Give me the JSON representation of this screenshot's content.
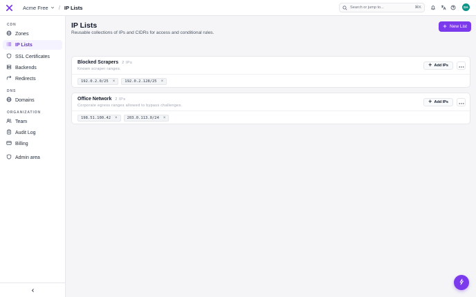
{
  "colors": {
    "accent": "#7c3aed",
    "avatar_bg": "#0d9488"
  },
  "header": {
    "org": "Acme Free",
    "separator": "/",
    "page": "IP Lists",
    "search": {
      "placeholder": "Search or jump to...",
      "shortcut": "⌘K"
    },
    "avatar_initials": "DA",
    "icons": [
      "logo-icon",
      "bell-icon",
      "translate-icon",
      "help-icon"
    ]
  },
  "sidebar": {
    "sections": [
      {
        "label": "CDN",
        "items": [
          {
            "label": "Zones",
            "icon": "globe-icon"
          },
          {
            "label": "IP Lists",
            "icon": "list-icon",
            "active": true
          },
          {
            "label": "SSL Certificates",
            "icon": "shield-icon"
          },
          {
            "label": "Backends",
            "icon": "server-icon"
          },
          {
            "label": "Redirects",
            "icon": "redirect-icon"
          }
        ]
      },
      {
        "label": "DNS",
        "items": [
          {
            "label": "Domains",
            "icon": "globe-icon"
          }
        ]
      },
      {
        "label": "ORGANIZATION",
        "items": [
          {
            "label": "Team",
            "icon": "users-icon"
          },
          {
            "label": "Audit Log",
            "icon": "clipboard-icon"
          },
          {
            "label": "Billing",
            "icon": "credit-card-icon"
          }
        ]
      }
    ],
    "admin": {
      "label": "Admin area",
      "icon": "shield-icon"
    },
    "collapse_icon": "chevron-left-icon"
  },
  "main": {
    "title": "IP Lists",
    "subtitle": "Reusable collections of IPs and CIDRs for access and conditional rules.",
    "new_button": "New List",
    "lists": [
      {
        "name": "Blocked Scrapers",
        "count": "2 IPs",
        "description": "Known scraper ranges.",
        "add_label": "Add IPs",
        "entries": [
          "192.0.2.0/25",
          "192.0.2.128/25"
        ]
      },
      {
        "name": "Office Network",
        "count": "2 IPs",
        "description": "Corporate egress ranges allowed to bypass challenges.",
        "add_label": "Add IPs",
        "entries": [
          "198.51.100.42",
          "203.0.113.0/24"
        ]
      }
    ]
  },
  "fab_icon": "sparkle-icon"
}
